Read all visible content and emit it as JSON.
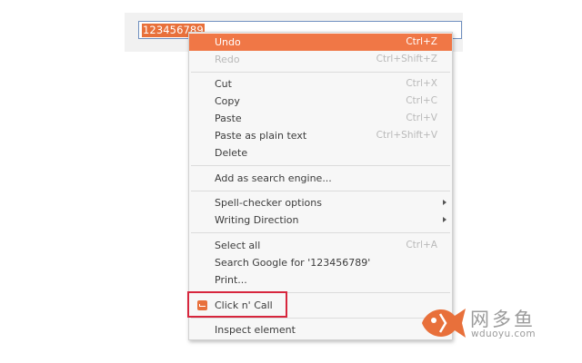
{
  "input": {
    "value": "123456789"
  },
  "menu": {
    "undo": {
      "label": "Undo",
      "shortcut": "Ctrl+Z"
    },
    "redo": {
      "label": "Redo",
      "shortcut": "Ctrl+Shift+Z"
    },
    "cut": {
      "label": "Cut",
      "shortcut": "Ctrl+X"
    },
    "copy": {
      "label": "Copy",
      "shortcut": "Ctrl+C"
    },
    "paste": {
      "label": "Paste",
      "shortcut": "Ctrl+V"
    },
    "paste_plain": {
      "label": "Paste as plain text",
      "shortcut": "Ctrl+Shift+V"
    },
    "delete": {
      "label": "Delete"
    },
    "add_search_engine": {
      "label": "Add as search engine..."
    },
    "spell_checker": {
      "label": "Spell-checker options"
    },
    "writing_direction": {
      "label": "Writing Direction"
    },
    "select_all": {
      "label": "Select all",
      "shortcut": "Ctrl+A"
    },
    "search_google": {
      "label": "Search Google for '123456789'"
    },
    "print": {
      "label": "Print..."
    },
    "click_n_call": {
      "label": "Click n' Call",
      "icon": "phone-extension-icon"
    },
    "inspect": {
      "label": "Inspect element"
    }
  },
  "colors": {
    "highlight": "#f07746",
    "selection": "#e8703b",
    "annotation": "#d7263d",
    "watermark": "#e8703b"
  },
  "watermark": {
    "title": "网多鱼",
    "subtitle": "wduoyu.com",
    "icon": "fish-logo-icon"
  }
}
